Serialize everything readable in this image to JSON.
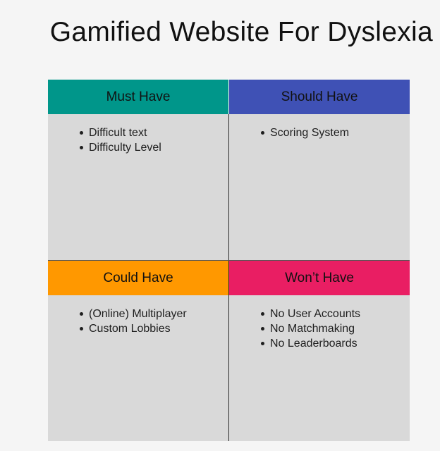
{
  "title": "Gamified Website For Dyslexia",
  "quadrants": [
    {
      "heading": "Must Have",
      "color": "#00968a",
      "items": [
        "Difficult text",
        "Difficulty Level"
      ]
    },
    {
      "heading": "Should Have",
      "color": "#3f51b5",
      "items": [
        "Scoring System"
      ]
    },
    {
      "heading": "Could Have",
      "color": "#ff9800",
      "items": [
        "(Online) Multiplayer",
        "Custom Lobbies"
      ]
    },
    {
      "heading": "Won’t Have",
      "color": "#e91e63",
      "items": [
        "No User Accounts",
        "No Matchmaking",
        "No Leaderboards"
      ]
    }
  ]
}
